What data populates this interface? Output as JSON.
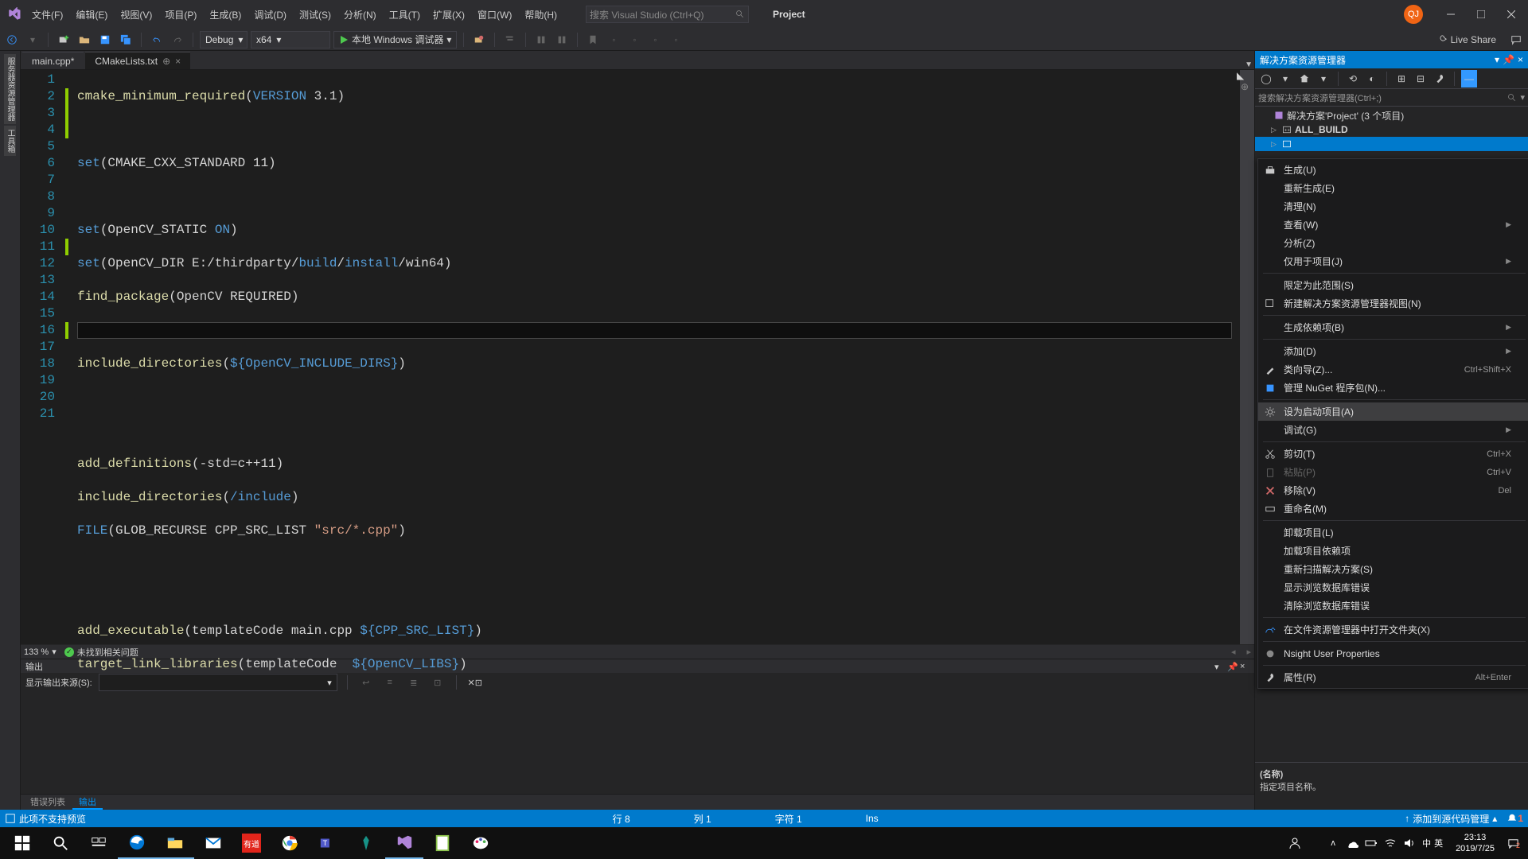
{
  "titlebar": {
    "menus": [
      "文件(F)",
      "编辑(E)",
      "视图(V)",
      "项目(P)",
      "生成(B)",
      "调试(D)",
      "测试(S)",
      "分析(N)",
      "工具(T)",
      "扩展(X)",
      "窗口(W)",
      "帮助(H)"
    ],
    "searchPlaceholder": "搜索 Visual Studio (Ctrl+Q)",
    "project": "Project",
    "userInitial": "QJ"
  },
  "toolbar": {
    "config": "Debug",
    "platform": "x64",
    "run": "本地 Windows 调试器",
    "liveShare": "Live Share"
  },
  "leftGutter": {
    "label1": "服务器资源管理器",
    "label2": "工具箱"
  },
  "tabs": {
    "t0": "main.cpp*",
    "t1": "CMakeLists.txt"
  },
  "code": {
    "l1a": "cmake_minimum_required",
    "l1b": "(",
    "l1c": "VERSION",
    "l1d": " 3.1",
    "l1e": ")",
    "l3a": "set",
    "l3b": "(CMAKE_CXX_STANDARD 11)",
    "l5a": "set",
    "l5b": "(OpenCV_STATIC ",
    "l5c": "ON",
    "l5d": ")",
    "l6a": "set",
    "l6b": "(OpenCV_DIR E:",
    "l6c": "/thirdparty/",
    "l6d": "build",
    "l6e": "/",
    "l6f": "install",
    "l6g": "/win64)",
    "l7a": "find_package",
    "l7b": "(OpenCV REQUIRED)",
    "l9a": "include_directories",
    "l9b": "(",
    "l9c": "${",
    "l9d": "OpenCV_INCLUDE_DIRS",
    "l9e": "}",
    "l9f": ")",
    "l12a": "add_definitions",
    "l12b": "(-std=c++11)",
    "l13a": "include_directories",
    "l13b": "(",
    "l13c": "/include",
    "l13d": ")",
    "l14a": "FILE",
    "l14b": "(GLOB_RECURSE CPP_SRC_LIST ",
    "l14c": "\"src/*.cpp\"",
    "l14d": ")",
    "l17a": "add_executable",
    "l17b": "(templateCode main.cpp ",
    "l17c": "${",
    "l17d": "CPP_SRC_LIST",
    "l17e": "}",
    "l17f": ")",
    "l18a": "target_link_libraries",
    "l18b": "(templateCode  ",
    "l18c": "${",
    "l18d": "OpenCV_LIBS",
    "l18e": "}",
    "l18f": ")"
  },
  "lineNums": [
    "1",
    "2",
    "3",
    "4",
    "5",
    "6",
    "7",
    "8",
    "9",
    "10",
    "11",
    "12",
    "13",
    "14",
    "15",
    "16",
    "17",
    "18",
    "19",
    "20",
    "21"
  ],
  "editorStatus": {
    "zoom": "133 %",
    "issues": "未找到相关问题"
  },
  "output": {
    "title": "输出",
    "srcLabel": "显示输出来源(S):",
    "tabErr": "错误列表",
    "tabOut": "输出"
  },
  "solution": {
    "title": "解决方案资源管理器",
    "searchPlaceholder": "搜索解决方案资源管理器(Ctrl+;)",
    "root": "解决方案'Project' (3 个项目)",
    "item1": "ALL_BUILD",
    "propsName": "(名称)",
    "propsDesc": "指定项目名称。"
  },
  "ctx": {
    "build": "生成(U)",
    "rebuild": "重新生成(E)",
    "clean": "清理(N)",
    "view": "查看(W)",
    "analyze": "分析(Z)",
    "projectOnly": "仅用于项目(J)",
    "scopeToThis": "限定为此范围(S)",
    "newView": "新建解决方案资源管理器视图(N)",
    "buildDeps": "生成依赖项(B)",
    "add": "添加(D)",
    "classWizard": "类向导(Z)...",
    "classWizardKey": "Ctrl+Shift+X",
    "nuget": "管理 NuGet 程序包(N)...",
    "setStartup": "设为启动项目(A)",
    "debug": "调试(G)",
    "cut": "剪切(T)",
    "cutKey": "Ctrl+X",
    "paste": "粘贴(P)",
    "pasteKey": "Ctrl+V",
    "remove": "移除(V)",
    "removeKey": "Del",
    "rename": "重命名(M)",
    "unload": "卸载项目(L)",
    "loadDeps": "加载项目依赖项",
    "rescan": "重新扫描解决方案(S)",
    "showBrowseErr": "显示浏览数据库错误",
    "clearBrowseErr": "清除浏览数据库错误",
    "openFolder": "在文件资源管理器中打开文件夹(X)",
    "nsight": "Nsight User Properties",
    "props": "属性(R)",
    "propsKey": "Alt+Enter"
  },
  "statusbar": {
    "msg": "此项不支持预览",
    "ln": "行 8",
    "col": "列 1",
    "ch": "字符 1",
    "ins": "Ins",
    "source": "添加到源代码管理"
  },
  "taskbar": {
    "ime1": "中",
    "ime2": "英",
    "time": "23:13",
    "date": "2019/7/25"
  }
}
